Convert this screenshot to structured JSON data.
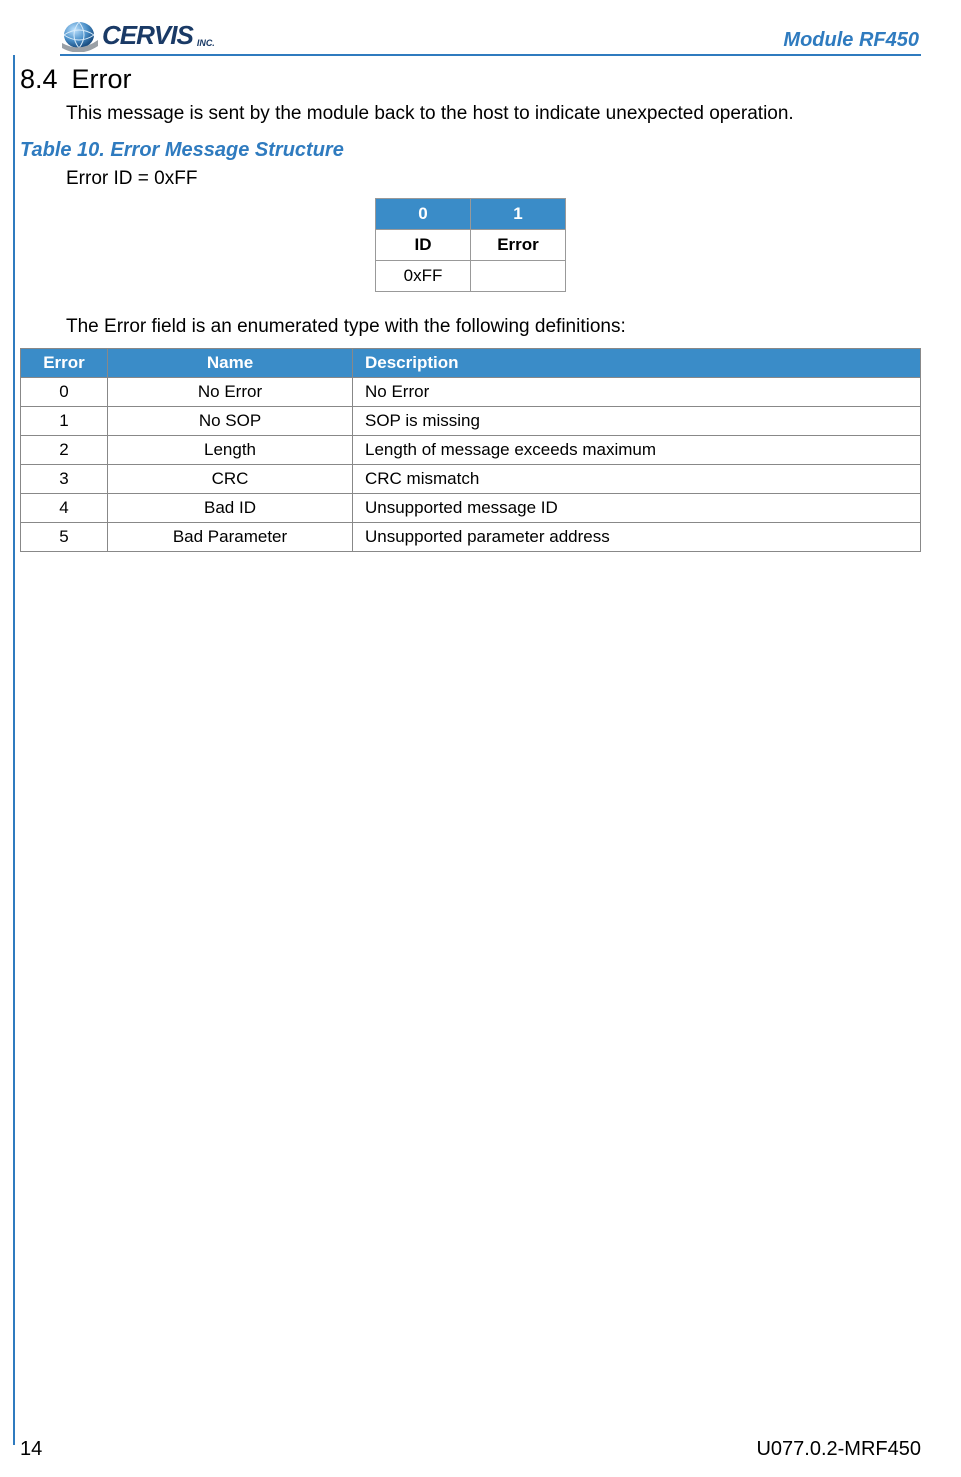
{
  "header": {
    "brand": "CERVIS",
    "brand_suffix": "INC.",
    "doc_title": "Module RF450"
  },
  "section": {
    "number": "8.4",
    "title": "Error",
    "intro": "This message is sent by the module back to the host to indicate unexpected operation."
  },
  "table_caption": "Table 10. Error Message Structure",
  "error_id_line": "Error ID = 0xFF",
  "struct_table": {
    "headers": [
      "0",
      "1"
    ],
    "labels": [
      "ID",
      "Error"
    ],
    "values": [
      "0xFF",
      ""
    ]
  },
  "enum_intro": "The Error field is an enumerated type with the following definitions:",
  "error_defs": {
    "columns": [
      "Error",
      "Name",
      "Description"
    ],
    "rows": [
      {
        "error": "0",
        "name": "No Error",
        "description": "No Error"
      },
      {
        "error": "1",
        "name": "No SOP",
        "description": "SOP is missing"
      },
      {
        "error": "2",
        "name": "Length",
        "description": "Length of message exceeds maximum"
      },
      {
        "error": "3",
        "name": "CRC",
        "description": "CRC mismatch"
      },
      {
        "error": "4",
        "name": "Bad ID",
        "description": "Unsupported message ID"
      },
      {
        "error": "5",
        "name": "Bad Parameter",
        "description": "Unsupported parameter address"
      }
    ]
  },
  "footer": {
    "page_number": "14",
    "doc_code": "U077.0.2-MRF450"
  }
}
